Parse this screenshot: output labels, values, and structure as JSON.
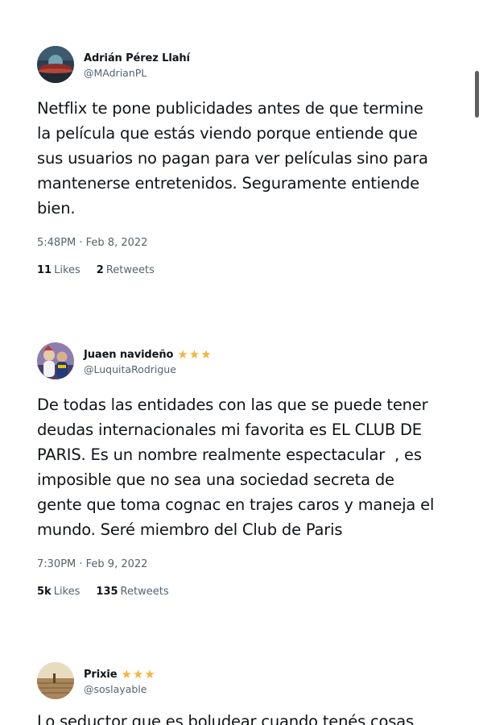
{
  "tweets": [
    {
      "display_name": "Adrián Pérez Llahí",
      "handle": "@MAdrianPL",
      "stars": 0,
      "text": "Netflix te pone publicidades antes de que termine\nla película que estás viendo porque entiende que\nsus usuarios no pagan para ver películas sino para\nmantenerse entretenidos. Seguramente entiende\nbien.",
      "timestamp": "5:48PM · Feb 8, 2022",
      "likes_count": "11",
      "likes_label": "Likes",
      "retweets_count": "2",
      "retweets_label": "Retweets",
      "avatar_icon": "landscape-avatar"
    },
    {
      "display_name": "Juaen navideño",
      "handle": "@LuquitaRodrigue",
      "stars": 3,
      "text": "De todas las entidades con las que se puede tener\ndeudas internacionales mi favorita es EL CLUB DE\nPARIS. Es un nombre realmente espectacular  , es\nimposible que no sea una sociedad secreta de\ngente que toma cognac en trajes caros y maneja el\nmundo. Seré miembro del Club de Paris",
      "timestamp": "7:30PM · Feb 9, 2022",
      "likes_count": "5k",
      "likes_label": "Likes",
      "retweets_count": "135",
      "retweets_label": "Retweets",
      "avatar_icon": "people-avatar"
    },
    {
      "display_name": "Prixie",
      "handle": "@soslayable",
      "stars": 3,
      "text": "Lo seductor que es boludear cuando tenés cosas",
      "avatar_icon": "field-avatar"
    }
  ],
  "star_glyph": "★",
  "colors": {
    "text": "#0f1419",
    "secondary": "#536471",
    "star": "#f4b43b"
  }
}
